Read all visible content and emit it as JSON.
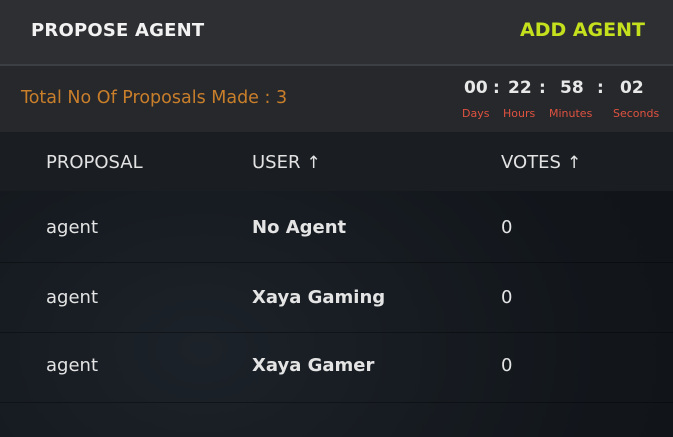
{
  "header": {
    "title": "PROPOSE AGENT",
    "add_label": "ADD AGENT"
  },
  "summary": {
    "total_label": "Total No Of Proposals Made : 3"
  },
  "timer": {
    "days": "00",
    "hours": "22",
    "minutes": "58",
    "seconds": "02",
    "separator": ":",
    "days_label": "Days",
    "hours_label": "Hours",
    "minutes_label": "Minutes",
    "seconds_label": "Seconds"
  },
  "table": {
    "headers": {
      "proposal": "PROPOSAL",
      "user": "USER",
      "votes": "VOTES",
      "sort_arrow": "↑"
    },
    "rows": [
      {
        "proposal": "agent",
        "user": "No Agent",
        "votes": "0"
      },
      {
        "proposal": "agent",
        "user": "Xaya Gaming",
        "votes": "0"
      },
      {
        "proposal": "agent",
        "user": "Xaya Gamer",
        "votes": "0"
      }
    ]
  },
  "colors": {
    "accent": "#c5e01c",
    "total_text": "#c97e2a",
    "timer_label": "#e0523f"
  }
}
